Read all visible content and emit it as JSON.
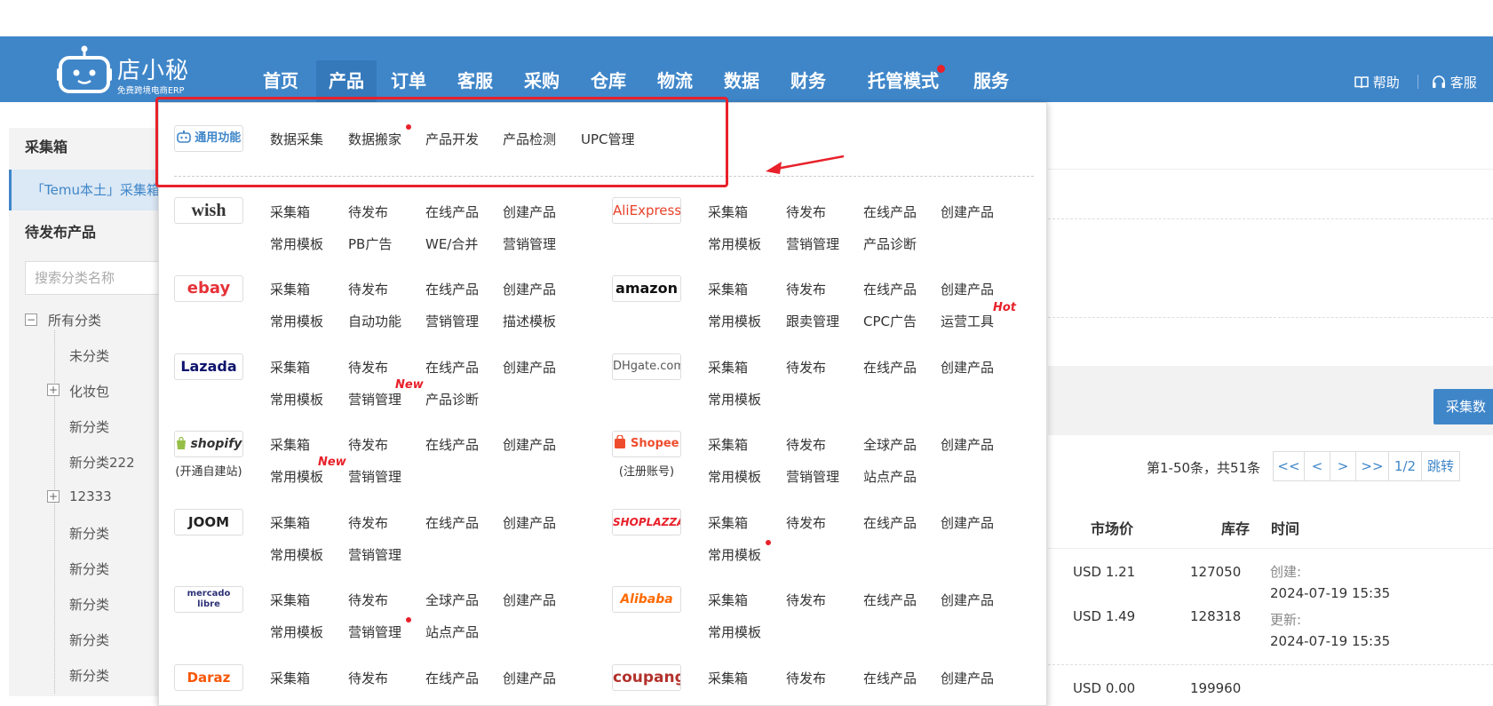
{
  "header": {
    "logo_name": "店小秘",
    "logo_sub": "免费跨境电商ERP",
    "nav": [
      {
        "label": "首页"
      },
      {
        "label": "产品"
      },
      {
        "label": "订单"
      },
      {
        "label": "客服"
      },
      {
        "label": "采购"
      },
      {
        "label": "仓库"
      },
      {
        "label": "物流"
      },
      {
        "label": "数据"
      },
      {
        "label": "财务"
      },
      {
        "label": "托管模式"
      },
      {
        "label": "服务"
      }
    ],
    "help": "帮助",
    "service": "客服"
  },
  "sidebar": {
    "section1": "采集箱",
    "active_item": "「Temu本土」采集箱",
    "section2": "待发布产品",
    "search_placeholder": "搜索分类名称",
    "tree": [
      "所有分类",
      "未分类",
      "化妆包",
      "新分类",
      "新分类222",
      "12333",
      "新分类",
      "新分类",
      "新分类",
      "新分类",
      "新分类"
    ]
  },
  "menu": {
    "general_badge": "通用功能",
    "general_items": [
      "数据采集",
      "数据搬家",
      "产品开发",
      "产品检测",
      "UPC管理"
    ],
    "platforms": [
      {
        "name": "wish",
        "row1": [
          "采集箱",
          "待发布",
          "在线产品",
          "创建产品"
        ],
        "row2": [
          "常用模板",
          "PB广告",
          "WE/合并",
          "营销管理"
        ]
      },
      {
        "name": "AliExpress",
        "row1": [
          "采集箱",
          "待发布",
          "在线产品",
          "创建产品"
        ],
        "row2": [
          "常用模板",
          "营销管理",
          "产品诊断"
        ]
      },
      {
        "name": "ebay",
        "row1": [
          "采集箱",
          "待发布",
          "在线产品",
          "创建产品"
        ],
        "row2": [
          "常用模板",
          "自动功能",
          "营销管理",
          "描述模板"
        ]
      },
      {
        "name": "amazon",
        "row1": [
          "采集箱",
          "待发布",
          "在线产品",
          "创建产品"
        ],
        "row2": [
          "常用模板",
          "跟卖管理",
          "CPC广告",
          "运营工具"
        ]
      },
      {
        "name": "Lazada",
        "row1": [
          "采集箱",
          "待发布",
          "在线产品",
          "创建产品"
        ],
        "row2": [
          "常用模板",
          "营销管理",
          "产品诊断"
        ]
      },
      {
        "name": "DHgate.com",
        "row1": [
          "采集箱",
          "待发布",
          "在线产品",
          "创建产品"
        ],
        "row2": [
          "常用模板"
        ]
      },
      {
        "name": "shopify",
        "sub": "(开通自建站)",
        "row1": [
          "采集箱",
          "待发布",
          "在线产品",
          "创建产品"
        ],
        "row2": [
          "常用模板",
          "营销管理"
        ]
      },
      {
        "name": "Shopee",
        "sub": "(注册账号)",
        "row1": [
          "采集箱",
          "待发布",
          "全球产品",
          "创建产品"
        ],
        "row2": [
          "常用模板",
          "营销管理",
          "站点产品"
        ]
      },
      {
        "name": "JOOM",
        "row1": [
          "采集箱",
          "待发布",
          "在线产品",
          "创建产品"
        ],
        "row2": [
          "常用模板",
          "营销管理"
        ]
      },
      {
        "name": "SHOPLAZZA",
        "row1": [
          "采集箱",
          "待发布",
          "在线产品",
          "创建产品"
        ],
        "row2": [
          "常用模板"
        ]
      },
      {
        "name": "mercado libre",
        "row1": [
          "采集箱",
          "待发布",
          "全球产品",
          "创建产品"
        ],
        "row2": [
          "常用模板",
          "营销管理",
          "站点产品"
        ]
      },
      {
        "name": "Alibaba",
        "row1": [
          "采集箱",
          "待发布",
          "在线产品",
          "创建产品"
        ],
        "row2": [
          "常用模板"
        ]
      },
      {
        "name": "Daraz",
        "row1": [
          "采集箱",
          "待发布",
          "在线产品",
          "创建产品"
        ],
        "row2": []
      },
      {
        "name": "coupang",
        "row1": [
          "采集箱",
          "待发布",
          "在线产品",
          "创建产品"
        ],
        "row2": []
      }
    ],
    "tag_hot": "Hot",
    "tag_new": "New"
  },
  "content": {
    "collect_btn": "采集数",
    "pager_text": "第1-50条，共51条",
    "pager": [
      "<<",
      "<",
      ">",
      ">>",
      "1/2",
      "跳转"
    ],
    "headers": [
      "市场价",
      "库存",
      "时间"
    ],
    "rows": [
      {
        "price": "USD 1.21",
        "stock": "127050"
      },
      {
        "price": "USD 1.49",
        "stock": "128318"
      },
      {
        "price": "USD 0.00",
        "stock": "199960"
      }
    ],
    "created_label": "创建:",
    "created": "2024-07-19 15:35",
    "updated_label": "更新:",
    "updated": "2024-07-19 15:35"
  },
  "colors": {
    "brand": "#3f86c9",
    "highlight": "#e8212a"
  }
}
